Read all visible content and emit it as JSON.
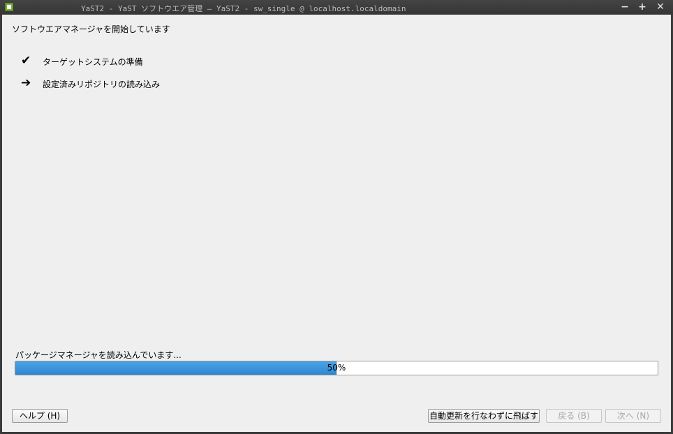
{
  "window": {
    "title": "YaST2 - YaST ソフトウエア管理 — YaST2 - sw_single @ localhost.localdomain",
    "controls": {
      "minimize": "−",
      "maximize": "+",
      "close": "✕"
    }
  },
  "main": {
    "heading": "ソフトウエアマネージャを開始しています",
    "steps": [
      {
        "icon": "✔",
        "label": "ターゲットシステムの準備",
        "status": "done"
      },
      {
        "icon": "➔",
        "label": "設定済みリポジトリの読み込み",
        "status": "current"
      }
    ]
  },
  "progress": {
    "label": "パッケージマネージャを読み込んでいます...",
    "percent": 50,
    "text": "50%",
    "fill_color": "#3a94dc"
  },
  "buttons": {
    "help": "ヘルプ (H)",
    "skip": "自動更新を行なわずに飛ばす",
    "back": "戻る (B)",
    "next": "次へ (N)"
  }
}
